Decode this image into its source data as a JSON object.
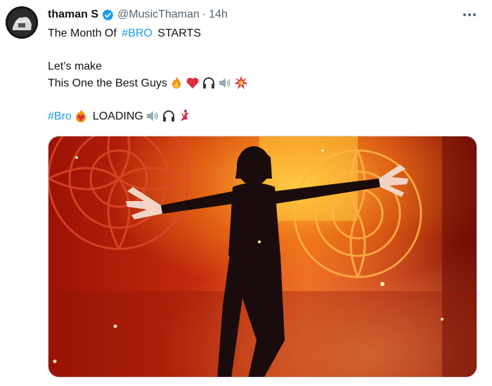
{
  "author": {
    "name": "thaman S",
    "handle": "@MusicThaman",
    "separator": "·",
    "time": "14h"
  },
  "tweet": {
    "line1_pre": "The Month Of ",
    "line1_tag": "#BRO",
    "line1_post": " STARTS",
    "line2": "Let’s make",
    "line3": "This One the Best Guys",
    "line4_tag": "#Bro",
    "line4_text": "LOADING"
  },
  "icons": {
    "verified": "verified-badge-icon",
    "more": "more-options-icon",
    "line3_emojis": [
      "fire",
      "red-heart",
      "headphone",
      "speaker",
      "collision"
    ],
    "line4_emojis": [
      "heart-on-fire",
      "speaker",
      "headphone",
      "dancer"
    ]
  },
  "colors": {
    "link": "#1d9bf0",
    "verified": "#1d9bf0",
    "secondary_text": "#536471"
  }
}
